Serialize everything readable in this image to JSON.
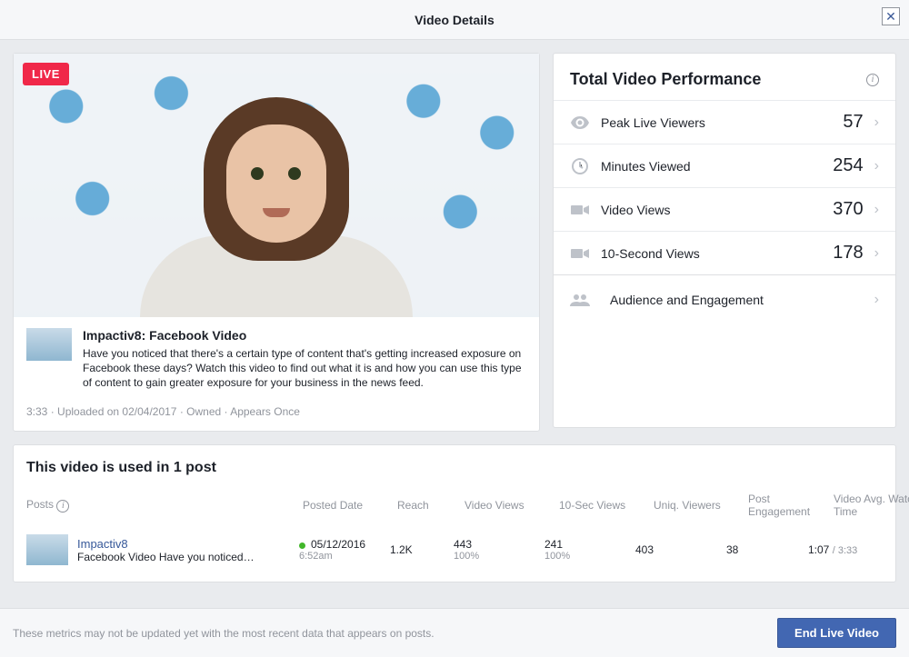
{
  "header": {
    "title": "Video Details"
  },
  "video": {
    "live_label": "LIVE",
    "title": "Impactiv8: Facebook Video",
    "description": "Have you noticed that there's a certain type of content that's getting increased exposure on Facebook these days? Watch this video to find out what it is and how you can use this type of content to gain greater exposure for your business in the news feed.",
    "duration": "3:33",
    "uploaded": "Uploaded on 02/04/2017",
    "ownership": "Owned",
    "appears": "Appears Once"
  },
  "performance": {
    "title": "Total Video Performance",
    "metrics": [
      {
        "label": "Peak Live Viewers",
        "value": "57",
        "icon": "eye"
      },
      {
        "label": "Minutes Viewed",
        "value": "254",
        "icon": "clock"
      },
      {
        "label": "Video Views",
        "value": "370",
        "icon": "camera"
      },
      {
        "label": "10-Second Views",
        "value": "178",
        "icon": "camera"
      }
    ],
    "engagement_label": "Audience and Engagement"
  },
  "posts": {
    "title": "This video is used in 1 post",
    "headers": {
      "posts": "Posts",
      "posted": "Posted Date",
      "reach": "Reach",
      "views": "Video Views",
      "tensec": "10-Sec Views",
      "uniq": "Uniq. Viewers",
      "engage": "Post Engagement",
      "watch": "Video Avg. Watch Time"
    },
    "rows": [
      {
        "name": "Impactiv8",
        "sub": "Facebook Video Have you noticed…",
        "date": "05/12/2016",
        "time": "6:52am",
        "reach": "1.2K",
        "views": "443",
        "views_pct": "100%",
        "tensec": "241",
        "tensec_pct": "100%",
        "uniq": "403",
        "engage": "38",
        "watch_avg": "1:07",
        "watch_total": "3:33"
      }
    ]
  },
  "footer": {
    "note": "These metrics may not be updated yet with the most recent data that appears on posts.",
    "button": "End Live Video"
  }
}
